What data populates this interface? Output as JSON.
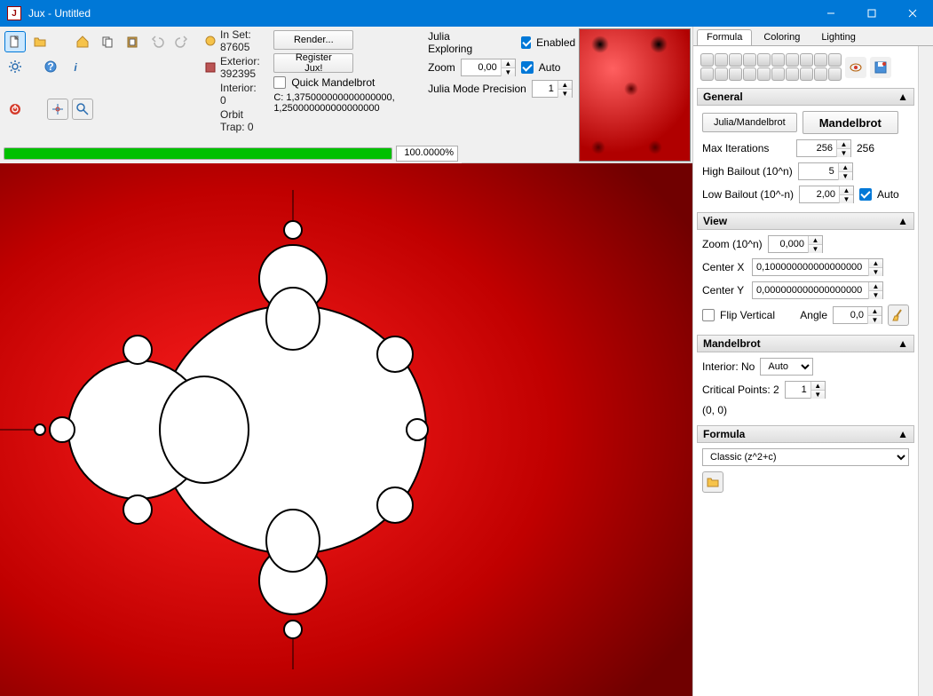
{
  "window": {
    "title": "Jux - Untitled"
  },
  "toolbar": {
    "render_label": "Render...",
    "register_label": "Register Jux!",
    "quick_mandel_label": "Quick Mandelbrot",
    "c_value": "C:  1,375000000000000000, 1,250000000000000000"
  },
  "stats": {
    "inset_label": "In Set: 87605",
    "exterior_label": "Exterior: 392395",
    "interior_label": "Interior: 0",
    "orbittrap_label": "Orbit Trap: 0"
  },
  "julia": {
    "heading": "Julia Exploring",
    "enabled_label": "Enabled",
    "zoom_label": "Zoom",
    "zoom_value": "0,00",
    "auto_label": "Auto",
    "precision_label": "Julia Mode Precision",
    "precision_value": "1"
  },
  "progress": {
    "percent": 100,
    "text": "100.0000%"
  },
  "tabs": {
    "formula": "Formula",
    "coloring": "Coloring",
    "lighting": "Lighting"
  },
  "sections": {
    "general": {
      "title": "General",
      "julia_button": "Julia/Mandelbrot",
      "mandel_button": "Mandelbrot",
      "maxiter_label": "Max Iterations",
      "maxiter_value": "256",
      "maxiter_suffix": "256",
      "hibail_label": "High Bailout (10^n)",
      "hibail_value": "5",
      "lobail_label": "Low Bailout (10^-n)",
      "lobail_value": "2,00",
      "lobail_auto": "Auto"
    },
    "view": {
      "title": "View",
      "zoom_label": "Zoom (10^n)",
      "zoom_value": "0,000",
      "cx_label": "Center X",
      "cx_value": "0,100000000000000000",
      "cy_label": "Center Y",
      "cy_value": "0,000000000000000000",
      "flip_label": "Flip Vertical",
      "angle_label": "Angle",
      "angle_value": "0,0"
    },
    "mandel": {
      "title": "Mandelbrot",
      "interior_label": "Interior: No",
      "interior_combo": "Auto",
      "critpts_label": "Critical Points:  2",
      "critpts_value": "1",
      "origin": "(0, 0)"
    },
    "formula": {
      "title": "Formula",
      "combo": "Classic (z^2+c)"
    }
  }
}
